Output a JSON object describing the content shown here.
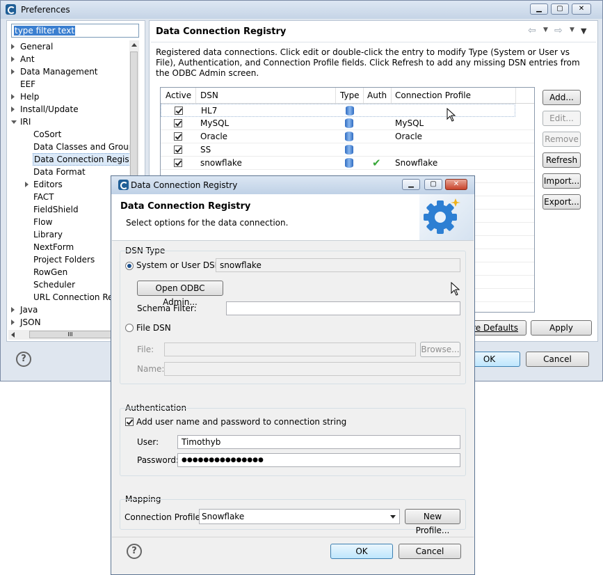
{
  "prefs": {
    "title": "Preferences",
    "filter_placeholder": "type filter text",
    "page_title": "Data Connection Registry",
    "description": "Registered data connections. Click edit or double-click the entry to modify Type (System or User vs File), Authentication, and Connection Profile fields. Click Refresh to add any missing DSN entries from the ODBC Admin screen.",
    "tree": [
      {
        "label": "General",
        "level": 0,
        "expand": "collapsed"
      },
      {
        "label": "Ant",
        "level": 0,
        "expand": "collapsed"
      },
      {
        "label": "Data Management",
        "level": 0,
        "expand": "collapsed"
      },
      {
        "label": "EEF",
        "level": 0,
        "expand": "none"
      },
      {
        "label": "Help",
        "level": 0,
        "expand": "collapsed"
      },
      {
        "label": "Install/Update",
        "level": 0,
        "expand": "collapsed"
      },
      {
        "label": "IRI",
        "level": 0,
        "expand": "expanded"
      },
      {
        "label": "CoSort",
        "level": 1,
        "expand": "none"
      },
      {
        "label": "Data Classes and Groups",
        "level": 1,
        "expand": "none"
      },
      {
        "label": "Data Connection Registry",
        "level": 1,
        "expand": "none",
        "selected": true
      },
      {
        "label": "Data Format",
        "level": 1,
        "expand": "none"
      },
      {
        "label": "Editors",
        "level": 1,
        "expand": "collapsed"
      },
      {
        "label": "FACT",
        "level": 1,
        "expand": "none"
      },
      {
        "label": "FieldShield",
        "level": 1,
        "expand": "none"
      },
      {
        "label": "Flow",
        "level": 1,
        "expand": "none"
      },
      {
        "label": "Library",
        "level": 1,
        "expand": "none"
      },
      {
        "label": "NextForm",
        "level": 1,
        "expand": "none"
      },
      {
        "label": "Project Folders",
        "level": 1,
        "expand": "none"
      },
      {
        "label": "RowGen",
        "level": 1,
        "expand": "none"
      },
      {
        "label": "Scheduler",
        "level": 1,
        "expand": "none"
      },
      {
        "label": "URL Connection Regi",
        "level": 1,
        "expand": "none"
      },
      {
        "label": "Java",
        "level": 0,
        "expand": "collapsed"
      },
      {
        "label": "JSON",
        "level": 0,
        "expand": "collapsed"
      }
    ],
    "columns": [
      "Active",
      "DSN",
      "Type",
      "Auth",
      "Connection Profile"
    ],
    "rows": [
      {
        "active": true,
        "dsn": "HL7",
        "auth": false,
        "profile": ""
      },
      {
        "active": true,
        "dsn": "MySQL",
        "auth": false,
        "profile": "MySQL"
      },
      {
        "active": true,
        "dsn": "Oracle",
        "auth": false,
        "profile": "Oracle"
      },
      {
        "active": true,
        "dsn": "SS",
        "auth": false,
        "profile": ""
      },
      {
        "active": true,
        "dsn": "snowflake",
        "auth": true,
        "profile": "Snowflake"
      }
    ],
    "side_buttons": [
      {
        "label": "Add...",
        "enabled": true
      },
      {
        "label": "Edit...",
        "enabled": false
      },
      {
        "label": "Remove",
        "enabled": false
      },
      {
        "label": "Refresh",
        "enabled": true
      },
      {
        "label": "Import...",
        "enabled": true
      },
      {
        "label": "Export...",
        "enabled": true
      }
    ],
    "restore_defaults": "tore Defaults",
    "apply": "Apply",
    "ok": "OK",
    "cancel": "Cancel",
    "scroll_thumb": "III"
  },
  "dialog": {
    "title": "Data Connection Registry",
    "heading": "Data Connection Registry",
    "subheading": "Select options for the data connection.",
    "dsn_group": "DSN Type",
    "system_dsn_label": "System or User DSN",
    "system_dsn_value": "snowflake",
    "open_odbc": "Open ODBC Admin...",
    "schema_filter_label": "Schema Filter:",
    "schema_filter_value": "",
    "file_dsn_label": "File DSN",
    "file_label": "File:",
    "browse": "Browse...",
    "name_label": "Name:",
    "auth_group": "Authentication",
    "auth_checkbox": "Add user name and password to connection string",
    "user_label": "User:",
    "user_value": "Timothyb",
    "password_label": "Password:",
    "password_value": "●●●●●●●●●●●●●●●",
    "mapping_group": "Mapping",
    "profile_label": "Connection Profile:",
    "profile_value": "Snowflake",
    "new_profile": "New Profile...",
    "ok": "OK",
    "cancel": "Cancel"
  }
}
